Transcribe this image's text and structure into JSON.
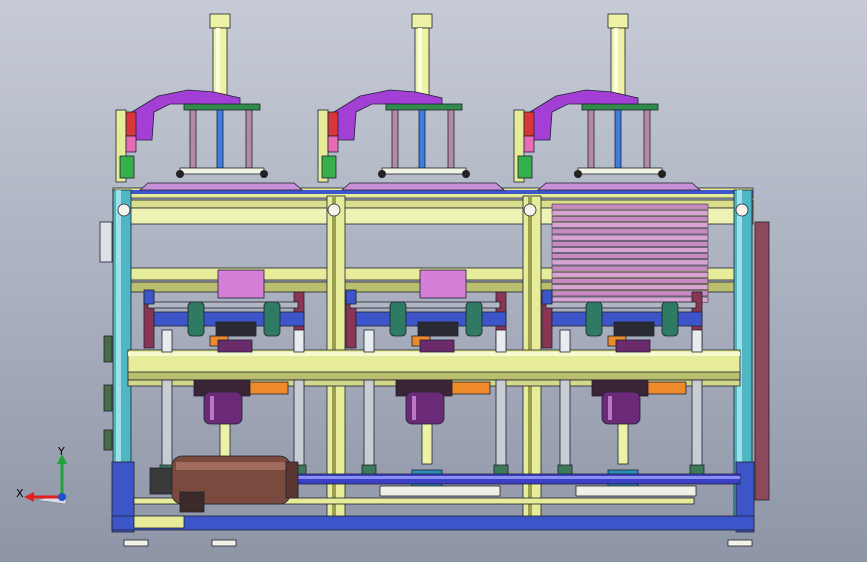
{
  "view": {
    "type": "cad-3d-model-view",
    "background_color": "#a8aebd"
  },
  "machine": {
    "station_count": 3,
    "colors": {
      "frame_yellow": "#e6ec9a",
      "frame_yellow_dark": "#b9bf6e",
      "blue_beam": "#3c55c8",
      "cyan_post": "#4fb6c4",
      "purple_arm": "#a43fd6",
      "cylinder_cream": "#eef2a6",
      "motor_brown": "#7a4a3e",
      "motor_violet": "#6a2a78",
      "rack_pink": "#c890d8",
      "stack_pink": "#c78bbf",
      "orange_block": "#ef8a2a",
      "green_roller": "#2f7a62",
      "red_block": "#d8363a",
      "green_block": "#36b04a",
      "steel_grey": "#c8cdd4"
    }
  },
  "triad": {
    "x_label": "X",
    "y_label": "Y",
    "x_color": "#e32020",
    "y_color": "#1fa33a",
    "z_color": "#1f4fd0"
  }
}
